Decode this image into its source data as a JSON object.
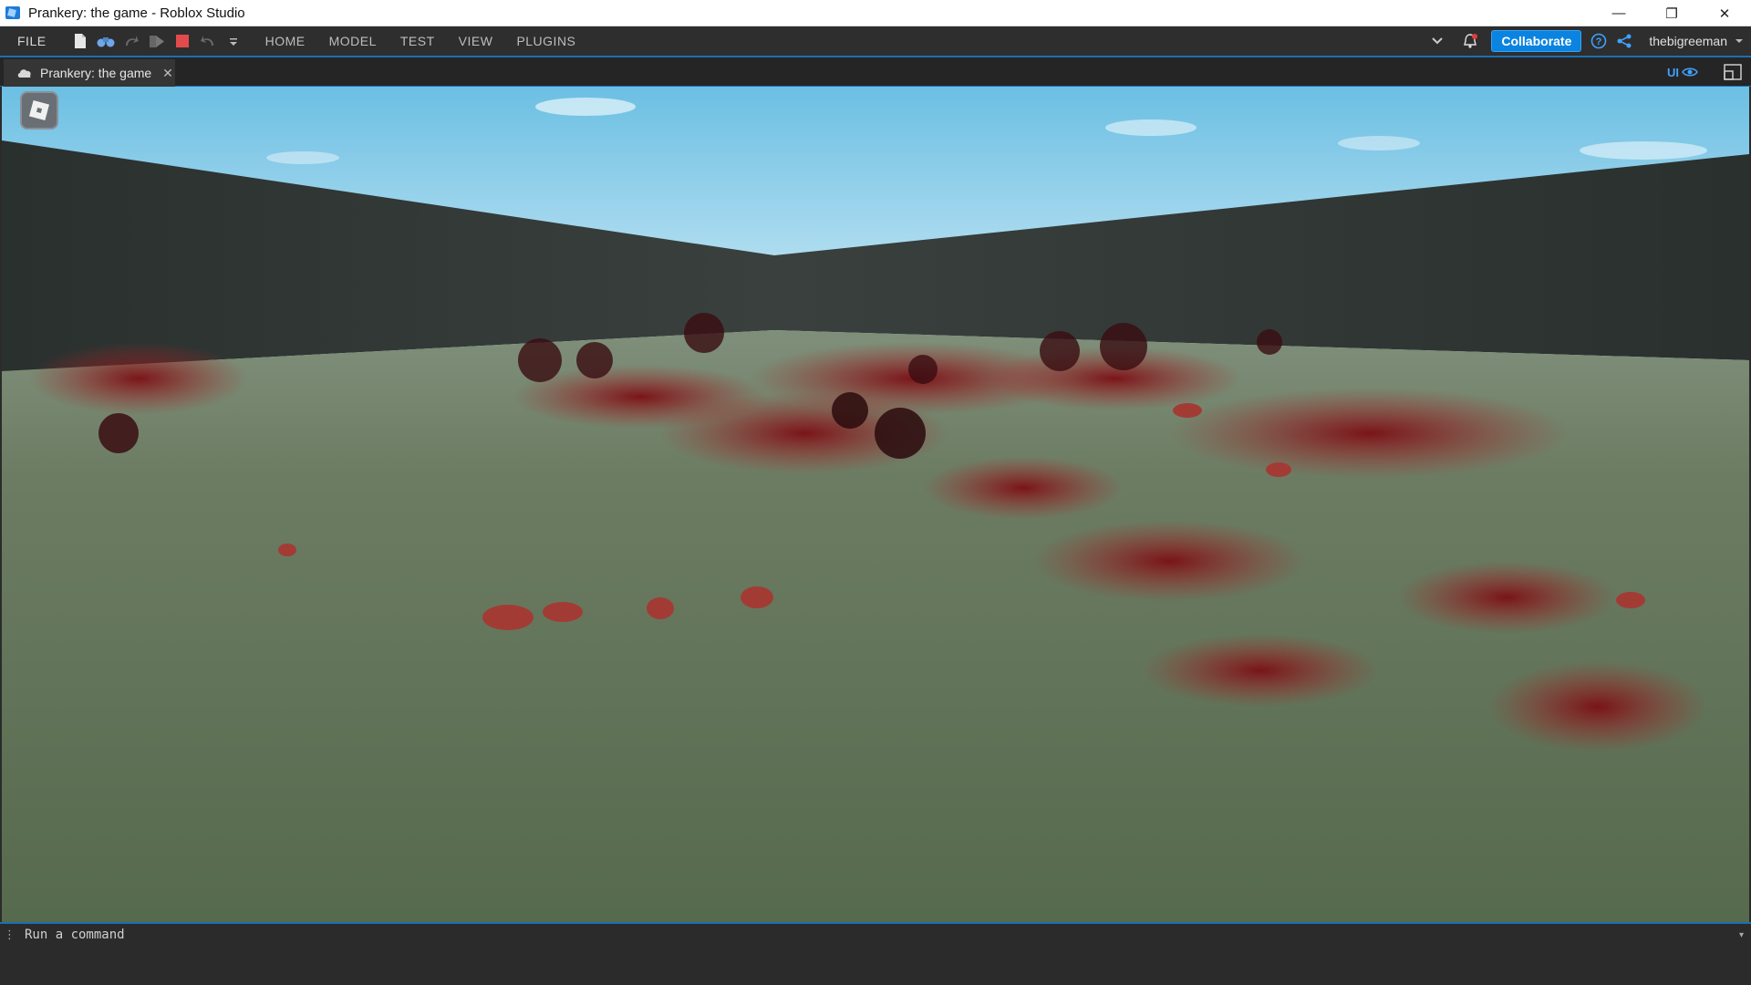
{
  "window": {
    "title": "Prankery: the game - Roblox Studio",
    "minimize_glyph": "—",
    "restore_glyph": "❐",
    "close_glyph": "✕"
  },
  "menubar": {
    "file_label": "FILE",
    "tabs": [
      {
        "label": "HOME"
      },
      {
        "label": "MODEL"
      },
      {
        "label": "TEST"
      },
      {
        "label": "VIEW"
      },
      {
        "label": "PLUGINS"
      }
    ],
    "quick_access_icons": [
      "new-file-icon",
      "binoculars-icon",
      "redo-icon",
      "play-icon",
      "stop-icon",
      "undo-icon",
      "customize-icon"
    ],
    "collaborate_label": "Collaborate",
    "username": "thebigreeman"
  },
  "tabstrip": {
    "document_tab": "Prankery: the game",
    "ui_toggle_label": "UI"
  },
  "commandbar": {
    "placeholder": "Run a command"
  },
  "colors": {
    "accent": "#0a84e0",
    "sky_top": "#6bbfe3",
    "wall": "#2f3533",
    "ground": "#5d6e55",
    "splatter": "#8a1a1f"
  }
}
